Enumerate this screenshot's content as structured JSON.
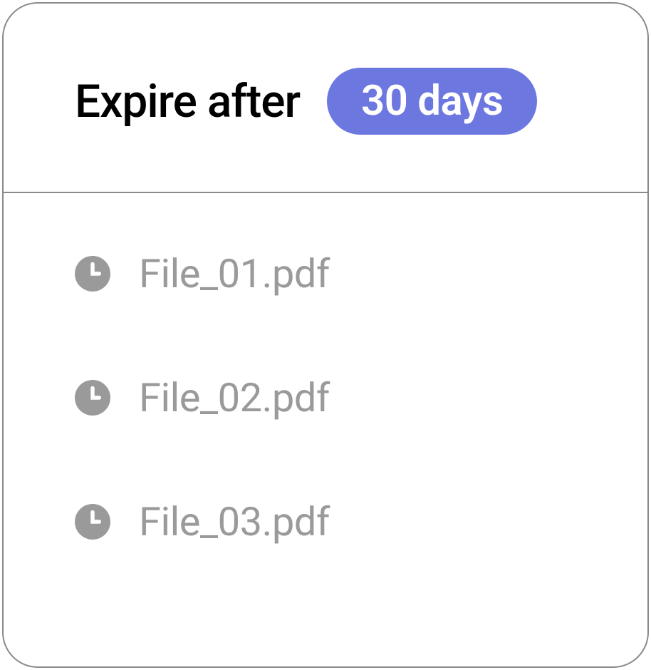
{
  "header": {
    "expire_label": "Expire after",
    "duration_label": "30 days"
  },
  "files": [
    {
      "name": "File_01.pdf"
    },
    {
      "name": "File_02.pdf"
    },
    {
      "name": "File_03.pdf"
    }
  ],
  "colors": {
    "accent": "#6d77e0",
    "muted": "#9a9a9a",
    "border": "#8a8a8a"
  }
}
